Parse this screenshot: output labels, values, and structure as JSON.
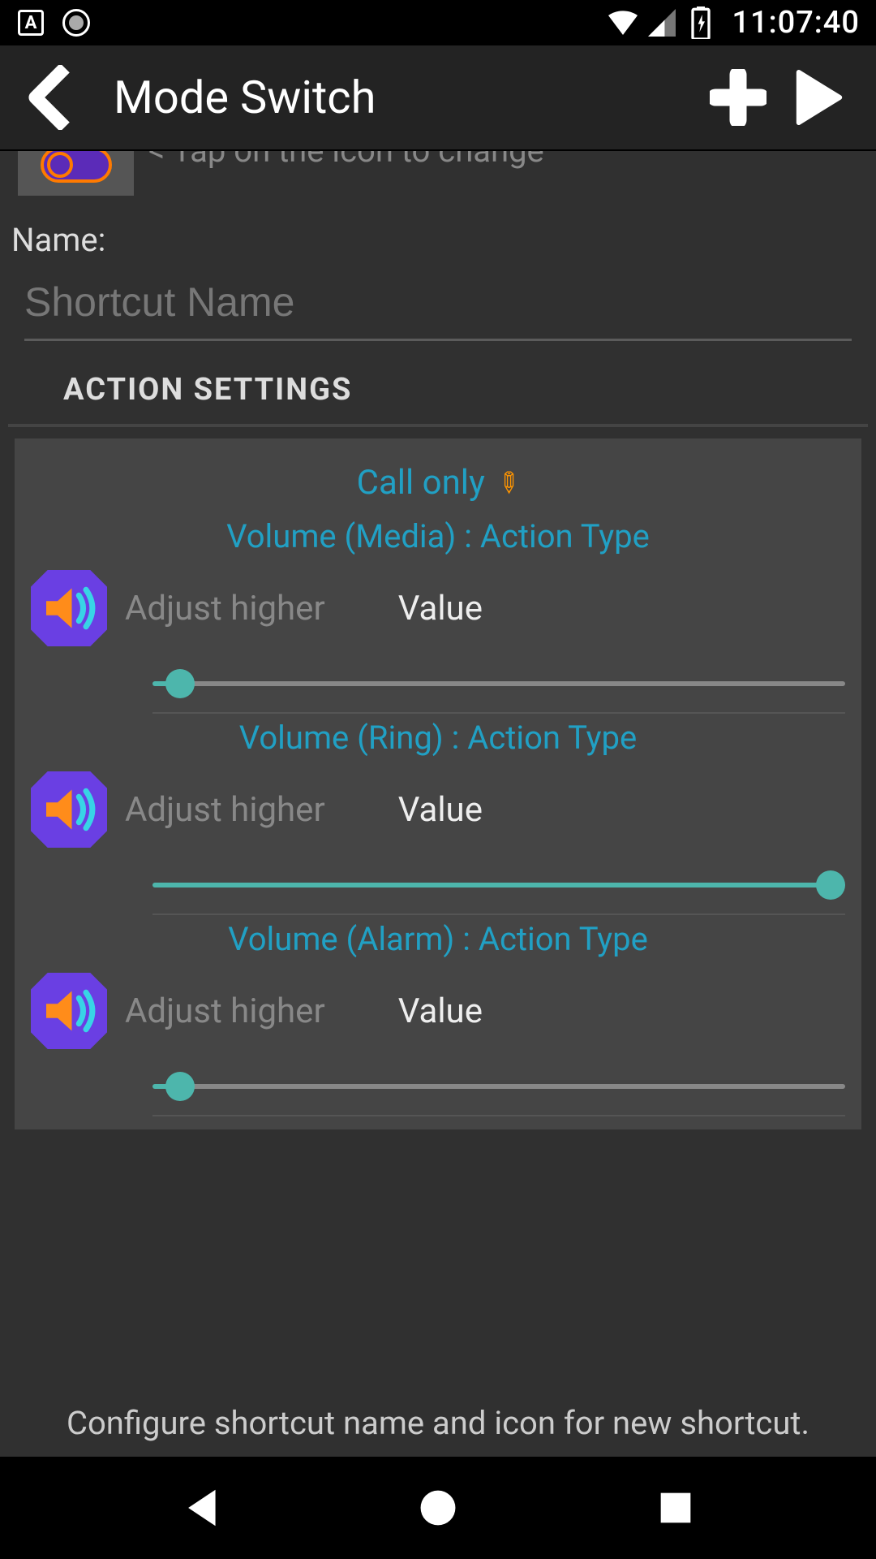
{
  "status": {
    "time": "11:07:40"
  },
  "header": {
    "title": "Mode Switch"
  },
  "icon_hint": "< Tap on the icon to change",
  "name_label": "Name:",
  "name_placeholder": "Shortcut Name",
  "section_title": "ACTION SETTINGS",
  "card": {
    "title": "Call only",
    "controls": [
      {
        "subtitle": "Volume (Media) : Action Type",
        "adjust": "Adjust higher",
        "value_label": "Value",
        "slider_percent": 2
      },
      {
        "subtitle": "Volume (Ring) : Action Type",
        "adjust": "Adjust higher",
        "value_label": "Value",
        "slider_percent": 100
      },
      {
        "subtitle": "Volume (Alarm) : Action Type",
        "adjust": "Adjust higher",
        "value_label": "Value",
        "slider_percent": 2
      }
    ]
  },
  "footer_hint": "Configure shortcut name and icon for new shortcut."
}
